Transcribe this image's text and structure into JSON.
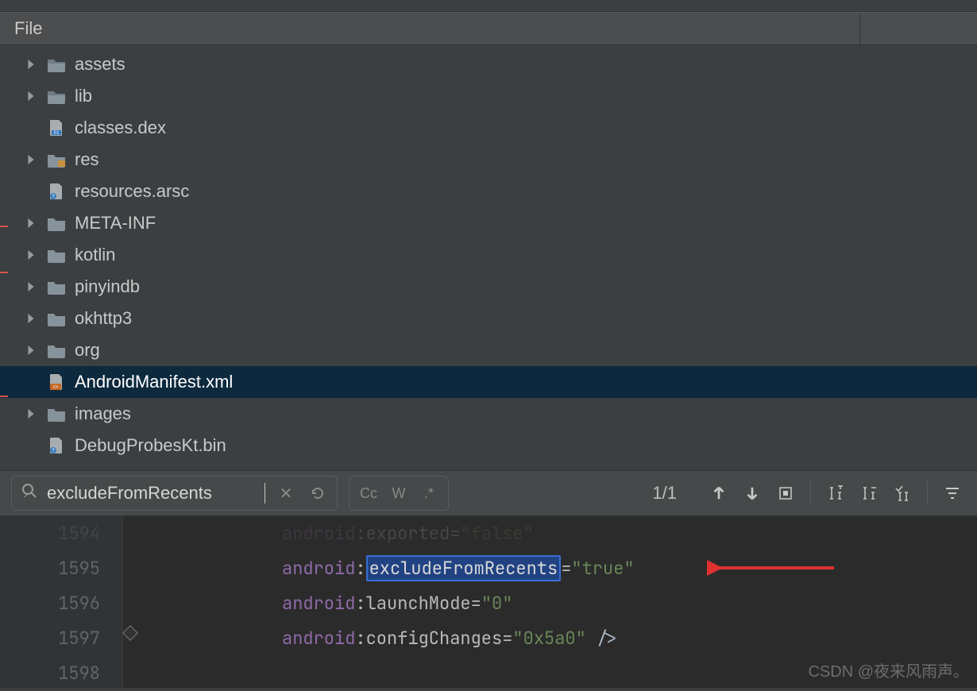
{
  "header": {
    "title": "File"
  },
  "tree": {
    "items": [
      {
        "label": "assets",
        "icon": "folder",
        "expandable": true,
        "selected": false
      },
      {
        "label": "lib",
        "icon": "folder",
        "expandable": true,
        "selected": false
      },
      {
        "label": "classes.dex",
        "icon": "file-binary",
        "expandable": false,
        "selected": false
      },
      {
        "label": "res",
        "icon": "folder-res",
        "expandable": true,
        "selected": false
      },
      {
        "label": "resources.arsc",
        "icon": "file-unknown",
        "expandable": false,
        "selected": false
      },
      {
        "label": "META-INF",
        "icon": "folder",
        "expandable": true,
        "selected": false
      },
      {
        "label": "kotlin",
        "icon": "folder",
        "expandable": true,
        "selected": false
      },
      {
        "label": "pinyindb",
        "icon": "folder",
        "expandable": true,
        "selected": false
      },
      {
        "label": "okhttp3",
        "icon": "folder",
        "expandable": true,
        "selected": false
      },
      {
        "label": "org",
        "icon": "folder",
        "expandable": true,
        "selected": false
      },
      {
        "label": "AndroidManifest.xml",
        "icon": "file-xml",
        "expandable": false,
        "selected": true
      },
      {
        "label": "images",
        "icon": "folder",
        "expandable": true,
        "selected": false
      },
      {
        "label": "DebugProbesKt.bin",
        "icon": "file-unknown",
        "expandable": false,
        "selected": false
      }
    ]
  },
  "find": {
    "query": "excludeFromRecents",
    "count": "1/1",
    "case_label": "Cc",
    "word_label": "W",
    "regex_label": ".*"
  },
  "editor": {
    "lines": [
      "1594",
      "1595",
      "1596",
      "1597",
      "1598"
    ],
    "code": {
      "ns": "android",
      "l1594_attr": "exported",
      "l1594_val": "\"false\"",
      "l1595_attr": "excludeFromRecents",
      "l1595_val": "\"true\"",
      "l1596_attr": "launchMode",
      "l1596_val": "\"0\"",
      "l1597_attr": "configChanges",
      "l1597_val": "\"0x5a0\"",
      "close_tag": "/>"
    }
  },
  "watermark": "CSDN @夜来风雨声。"
}
